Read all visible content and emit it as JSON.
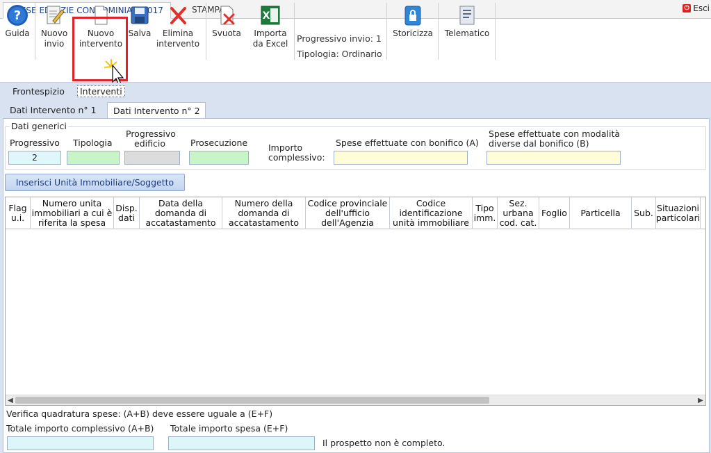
{
  "tabs": {
    "main": "SPESE EDILIZIE CONDOMINIALI 2017",
    "print": "STAMPA"
  },
  "exit": {
    "icon": "exit-icon",
    "label": "Esci"
  },
  "ribbon": {
    "guide": "Guida",
    "new_send": [
      "Nuovo",
      "invio"
    ],
    "new_intervention": [
      "Nuovo",
      "intervento"
    ],
    "save": "Salva",
    "delete_intervention": [
      "Elimina",
      "intervento"
    ],
    "empty": "Svuota",
    "import_excel": [
      "Importa",
      "da Excel"
    ],
    "progressivo_invio": "Progressivo invio: 1",
    "tipologia": "Tipologia: Ordinario",
    "storicizza": "Storicizza",
    "telematico": "Telematico"
  },
  "section_tabs": {
    "frontespizio": "Frontespizio",
    "interventi": "Interventi"
  },
  "intervention_tabs": [
    "Dati Intervento n° 1",
    "Dati Intervento n° 2"
  ],
  "dati_generici": {
    "title": "Dati generici",
    "progressivo_label": "Progressivo",
    "progressivo_value": "2",
    "tipologia_label": "Tipologia",
    "progressivo_edificio_label": [
      "Progressivo",
      "edificio"
    ],
    "prosecuzione_label": "Prosecuzione",
    "importo_label": [
      "Importo",
      "complessivo:"
    ],
    "spese_bonifico_label": "Spese effettuate con bonifico (A)",
    "spese_modalita_label": [
      "Spese effettuate con modalità",
      "diverse dal bonifico (B)"
    ]
  },
  "insert_button": "Inserisci Unità Immobiliare/Soggetto",
  "table": {
    "columns": [
      [
        "Flag",
        "u.i."
      ],
      [
        "Numero unita",
        "immobiliari a cui è",
        "riferita la spesa"
      ],
      [
        "Disp.",
        "dati"
      ],
      [
        "Data della",
        "domanda di",
        "accatastamento"
      ],
      [
        "Numero della",
        "domanda di",
        "accatastamento"
      ],
      [
        "Codice provinciale",
        "dell'ufficio",
        "dell'Agenzia"
      ],
      [
        "Codice",
        "identificazione",
        "unità immobiliare"
      ],
      [
        "Tipo",
        "imm."
      ],
      [
        "Sez.",
        "urbana",
        "cod. cat."
      ],
      [
        "Foglio"
      ],
      [
        "Particella"
      ],
      [
        "Sub."
      ],
      [
        "Situazioni",
        "particolari"
      ]
    ],
    "rows": []
  },
  "footer": {
    "verifica": "Verifica quadratura spese: (A+B) deve essere uguale a (E+F)",
    "totale_complessivo_label": "Totale importo complessivo (A+B)",
    "totale_spesa_label": "Totale importo spesa (E+F)",
    "status": "Il prospetto non è completo."
  },
  "colors": {
    "selection": "#e0202a",
    "accent": "#1a3f8a",
    "panel": "#d8e2f0"
  }
}
